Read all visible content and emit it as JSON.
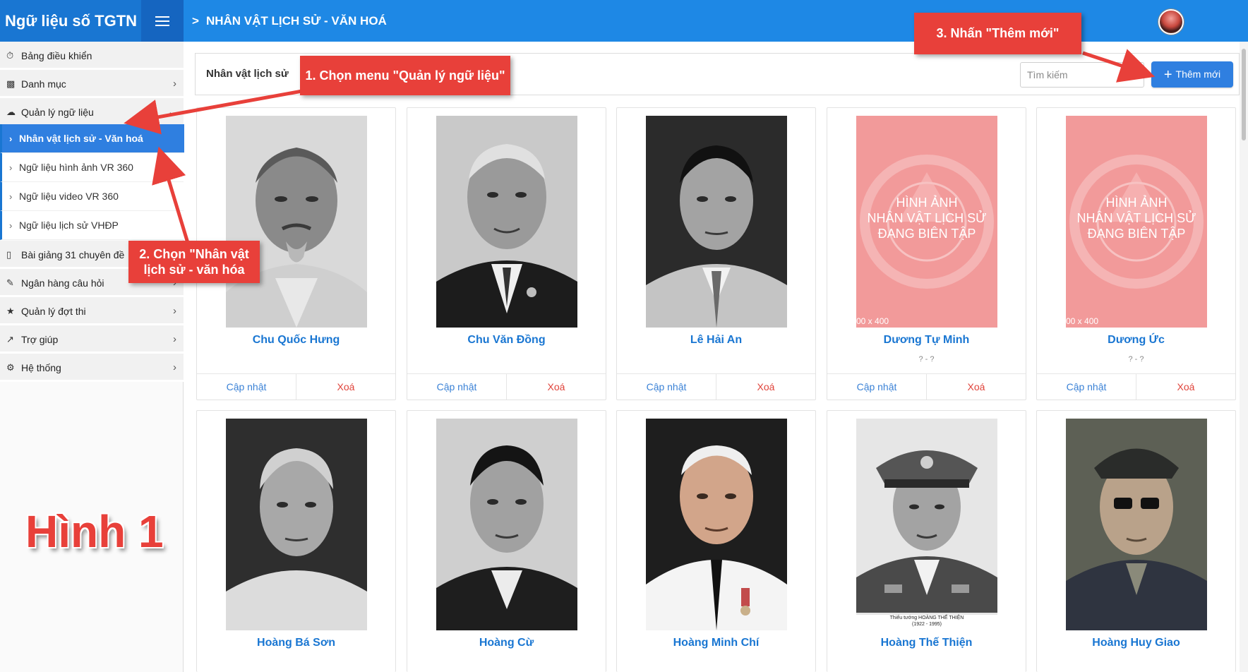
{
  "app": {
    "title": "Ngữ liệu số TGTN"
  },
  "header": {
    "breadcrumb": "NHÂN VẬT LỊCH SỬ - VĂN HOÁ"
  },
  "sidebar": {
    "items": [
      {
        "label": "Bảng điều khiển",
        "icon": "dashboard-icon",
        "has_arrow": false
      },
      {
        "label": "Danh mục",
        "icon": "folder-icon",
        "has_arrow": true
      },
      {
        "label": "Quản lý ngữ liệu",
        "icon": "cloud-icon",
        "has_arrow": true,
        "expanded": true
      },
      {
        "label": "Bài giảng 31 chuyên đề",
        "icon": "book-icon",
        "has_arrow": false
      },
      {
        "label": "Ngân hàng câu hỏi",
        "icon": "edit-icon",
        "has_arrow": true
      },
      {
        "label": "Quản lý đợt thi",
        "icon": "trophy-icon",
        "has_arrow": true
      },
      {
        "label": "Trợ giúp",
        "icon": "chart-icon",
        "has_arrow": true
      },
      {
        "label": "Hệ thống",
        "icon": "cogs-icon",
        "has_arrow": true
      }
    ],
    "subitems": [
      {
        "label": "Nhân vật lịch sử - Văn hoá",
        "active": true
      },
      {
        "label": "Ngữ liệu hình ảnh VR 360",
        "active": false
      },
      {
        "label": "Ngữ liệu video VR 360",
        "active": false
      },
      {
        "label": "Ngữ liệu lịch sử VHĐP",
        "active": false
      }
    ]
  },
  "toolbar": {
    "section_title": "Nhân vật lịch sử",
    "search_placeholder": "Tìm kiếm",
    "add_label": "Thêm mới"
  },
  "cards": [
    {
      "name": "Chu Quốc Hưng",
      "years": "",
      "update_label": "Cập nhật",
      "delete_label": "Xoá"
    },
    {
      "name": "Chu Văn Đồng",
      "years": "",
      "update_label": "Cập nhật",
      "delete_label": "Xoá"
    },
    {
      "name": "Lê Hải An",
      "years": "",
      "update_label": "Cập nhật",
      "delete_label": "Xoá"
    },
    {
      "name": "Dương Tự Minh",
      "years": "? - ?",
      "update_label": "Cập nhật",
      "delete_label": "Xoá",
      "placeholder_text": "HÌNH ẢNH\nNHÂN VẬT LỊCH SỬ\nĐANG BIÊN TẬP",
      "placeholder_size": "00 x 400"
    },
    {
      "name": "Dương Ức",
      "years": "? - ?",
      "update_label": "Cập nhật",
      "delete_label": "Xoá",
      "placeholder_text": "HÌNH ẢNH\nNHÂN VẬT LỊCH SỬ\nĐANG BIÊN TẬP",
      "placeholder_size": "00 x 400"
    },
    {
      "name": "Hoàng Bá Sơn"
    },
    {
      "name": "Hoàng Cừ"
    },
    {
      "name": "Hoàng Minh Chí"
    },
    {
      "name": "Hoàng Thế Thiện",
      "photo_caption": "Thiếu tướng HOÀNG THẾ THIỆN\n(1922 - 1995)"
    },
    {
      "name": "Hoàng Huy Giao"
    }
  ],
  "annotations": {
    "step1": "1. Chọn menu \"Quản lý ngữ liệu\"",
    "step2": "2. Chọn \"Nhân vật\nlịch sử - văn hóa",
    "step3": "3. Nhấn \"Thêm mới\"",
    "figure_label": "Hình 1",
    "color": "#e8403a"
  },
  "colors": {
    "primary": "#1e88e5",
    "brand_bg": "#1976d2",
    "active": "#2f7fe0",
    "delete": "#e0433a"
  }
}
